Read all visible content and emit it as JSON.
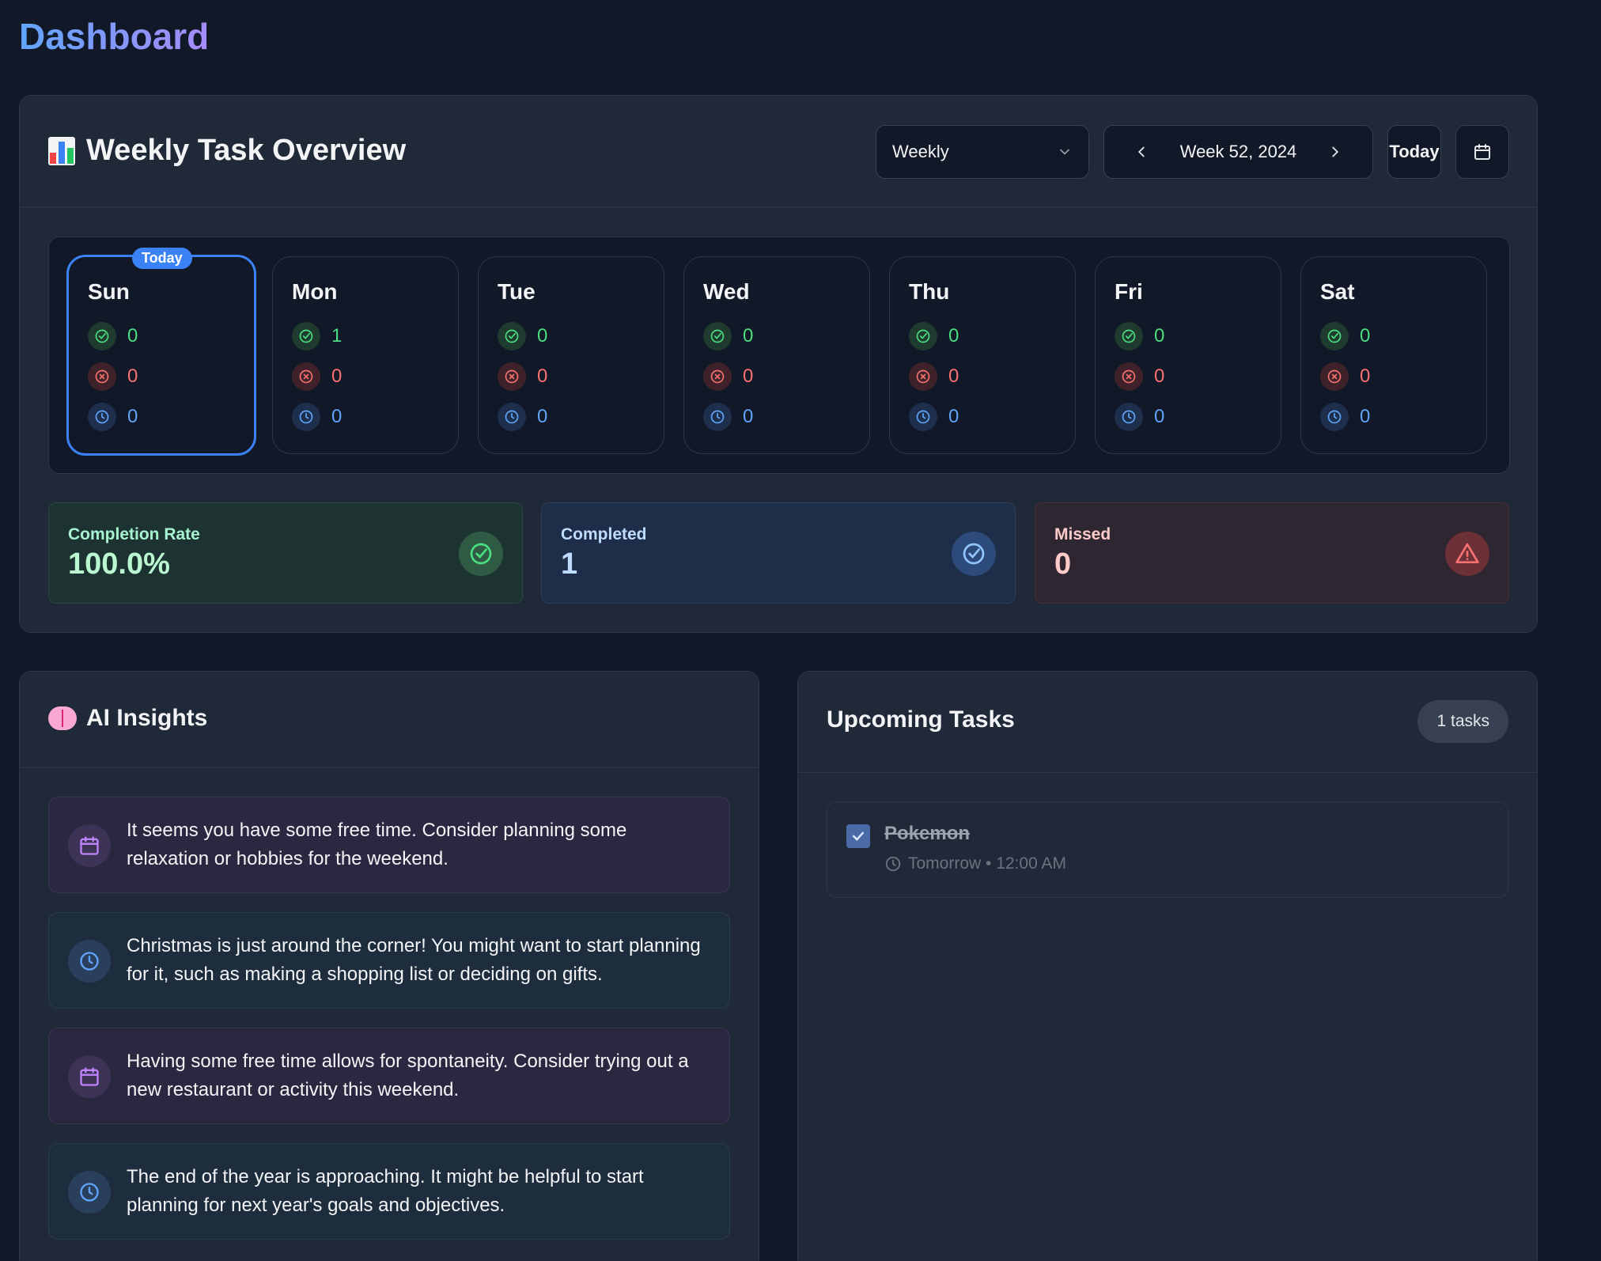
{
  "page": {
    "title": "Dashboard"
  },
  "overview": {
    "title": "Weekly Task Overview",
    "period": "Weekly",
    "week_label": "Week 52, 2024",
    "today_button": "Today",
    "today_badge": "Today",
    "days": [
      {
        "name": "Sun",
        "completed": "0",
        "missed": "0",
        "pending": "0"
      },
      {
        "name": "Mon",
        "completed": "1",
        "missed": "0",
        "pending": "0"
      },
      {
        "name": "Tue",
        "completed": "0",
        "missed": "0",
        "pending": "0"
      },
      {
        "name": "Wed",
        "completed": "0",
        "missed": "0",
        "pending": "0"
      },
      {
        "name": "Thu",
        "completed": "0",
        "missed": "0",
        "pending": "0"
      },
      {
        "name": "Fri",
        "completed": "0",
        "missed": "0",
        "pending": "0"
      },
      {
        "name": "Sat",
        "completed": "0",
        "missed": "0",
        "pending": "0"
      }
    ],
    "summary": {
      "completion_rate_label": "Completion Rate",
      "completion_rate_value": "100.0%",
      "completed_label": "Completed",
      "completed_value": "1",
      "missed_label": "Missed",
      "missed_value": "0"
    }
  },
  "insights": {
    "title": "AI Insights",
    "items": [
      {
        "icon": "calendar-icon",
        "text": "It seems you have some free time. Consider planning some relaxation or hobbies for the weekend."
      },
      {
        "icon": "clock-icon",
        "text": "Christmas is just around the corner! You might want to start planning for it, such as making a shopping list or deciding on gifts."
      },
      {
        "icon": "calendar-icon",
        "text": "Having some free time allows for spontaneity. Consider trying out a new restaurant or activity this weekend."
      },
      {
        "icon": "clock-icon",
        "text": "The end of the year is approaching. It might be helpful to start planning for next year's goals and objectives."
      }
    ]
  },
  "upcoming": {
    "title": "Upcoming Tasks",
    "count_label": "1 tasks",
    "tasks": [
      {
        "name": "Pokemon",
        "meta": "Tomorrow • 12:00 AM",
        "done": true
      }
    ]
  },
  "colors": {
    "background": "#111827",
    "card": "#1f2937",
    "accent": "#3b82f6",
    "completed": "#4ade80",
    "missed": "#f87171",
    "pending": "#60a5fa"
  }
}
